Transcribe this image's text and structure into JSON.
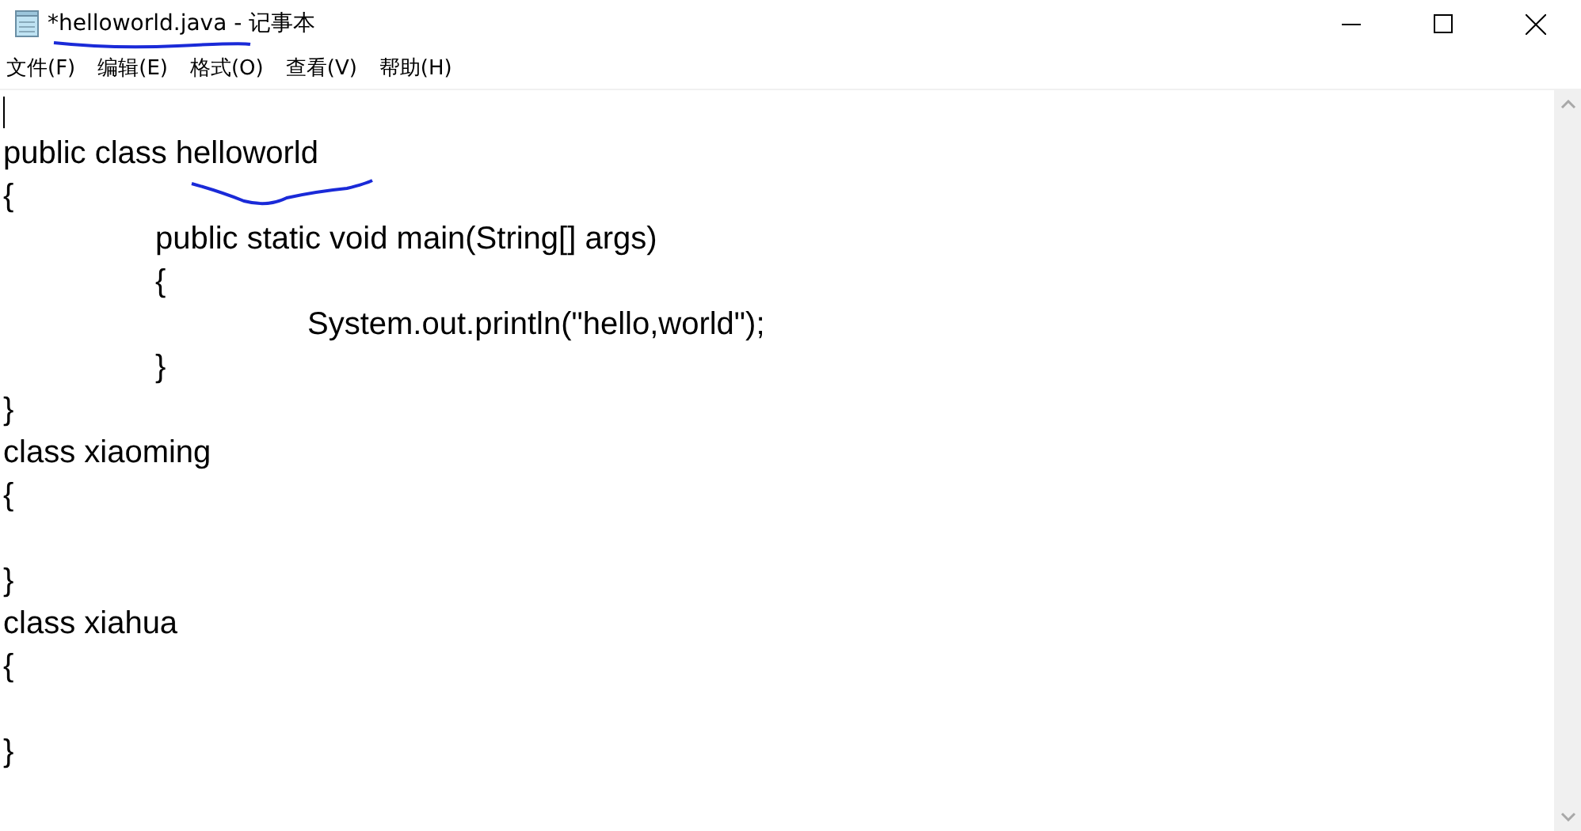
{
  "window": {
    "title": "*helloworld.java - 记事本"
  },
  "menu": [
    {
      "label": "文件(F)"
    },
    {
      "label": "编辑(E)"
    },
    {
      "label": "格式(O)"
    },
    {
      "label": "查看(V)"
    },
    {
      "label": "帮助(H)"
    }
  ],
  "editor": {
    "text": "\npublic class helloworld\n{\n\tpublic static void main(String[] args)\n\t{\n\t\tSystem.out.println(\"hello,world\");\n\t}\n}\nclass xiaoming\n{\n\n}\nclass xiahua\n{\n\n}"
  }
}
